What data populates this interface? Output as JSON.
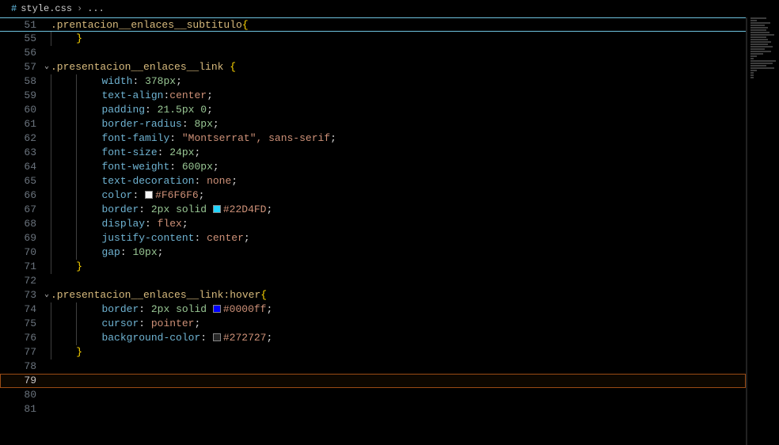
{
  "breadcrumb": {
    "icon": "#",
    "file": "style.css",
    "chev": "›",
    "scope": "..."
  },
  "sticky": {
    "num": "51",
    "sel": ".prentacion__enlaces__subtitulo",
    "brace": "{"
  },
  "lines": [
    {
      "num": "55",
      "indent": 1,
      "type": "brace-close",
      "text": "}"
    },
    {
      "num": "56",
      "indent": 0,
      "type": "empty",
      "text": ""
    },
    {
      "num": "57",
      "indent": 0,
      "type": "selector",
      "fold": true,
      "sel": ".presentacion__enlaces__link ",
      "brace": "{"
    },
    {
      "num": "58",
      "indent": 2,
      "type": "decl",
      "prop": "width",
      "colon": ": ",
      "val": "378px",
      "semi": ";"
    },
    {
      "num": "59",
      "indent": 2,
      "type": "decl",
      "prop": "text-align",
      "colon": ":",
      "val": "center",
      "semi": ";"
    },
    {
      "num": "60",
      "indent": 2,
      "type": "decl",
      "prop": "padding",
      "colon": ": ",
      "val": "21.5px 0",
      "semi": ";"
    },
    {
      "num": "61",
      "indent": 2,
      "type": "decl",
      "prop": "border-radius",
      "colon": ": ",
      "val": "8px",
      "semi": ";"
    },
    {
      "num": "62",
      "indent": 2,
      "type": "decl",
      "prop": "font-family",
      "colon": ": ",
      "str": "\"Montserrat\"",
      "rest": ", sans-serif",
      "semi": ";"
    },
    {
      "num": "63",
      "indent": 2,
      "type": "decl",
      "prop": "font-size",
      "colon": ": ",
      "val": "24px",
      "semi": ";"
    },
    {
      "num": "64",
      "indent": 2,
      "type": "decl",
      "prop": "font-weight",
      "colon": ": ",
      "val": "600px",
      "semi": ";"
    },
    {
      "num": "65",
      "indent": 2,
      "type": "decl",
      "prop": "text-decoration",
      "colon": ": ",
      "val": "none",
      "semi": ";"
    },
    {
      "num": "66",
      "indent": 2,
      "type": "color",
      "prop": "color",
      "colon": ": ",
      "swatch": "#F6F6F6",
      "val": "#F6F6F6",
      "semi": ";"
    },
    {
      "num": "67",
      "indent": 2,
      "type": "border",
      "prop": "border",
      "colon": ": ",
      "pre": "2px solid ",
      "swatch": "#22D4FD",
      "val": "#22D4FD",
      "semi": ";"
    },
    {
      "num": "68",
      "indent": 2,
      "type": "decl",
      "prop": "display",
      "colon": ": ",
      "val": "flex",
      "semi": ";"
    },
    {
      "num": "69",
      "indent": 2,
      "type": "decl",
      "prop": "justify-content",
      "colon": ": ",
      "val": "center",
      "semi": ";"
    },
    {
      "num": "70",
      "indent": 2,
      "type": "decl",
      "prop": "gap",
      "colon": ": ",
      "val": "10px",
      "semi": ";"
    },
    {
      "num": "71",
      "indent": 1,
      "type": "brace-close",
      "text": "}"
    },
    {
      "num": "72",
      "indent": 0,
      "type": "empty",
      "text": ""
    },
    {
      "num": "73",
      "indent": 0,
      "type": "selector",
      "fold": true,
      "sel": ".presentacion__enlaces__link:hover",
      "brace": "{"
    },
    {
      "num": "74",
      "indent": 2,
      "type": "border",
      "prop": "border",
      "colon": ": ",
      "pre": "2px solid ",
      "swatch": "#0000ff",
      "val": "#0000ff",
      "semi": ";"
    },
    {
      "num": "75",
      "indent": 2,
      "type": "decl",
      "prop": "cursor",
      "colon": ": ",
      "val": "pointer",
      "semi": ";"
    },
    {
      "num": "76",
      "indent": 2,
      "type": "color",
      "prop": "background-color",
      "colon": ": ",
      "swatch": "#272727",
      "val": "#272727",
      "semi": ";"
    },
    {
      "num": "77",
      "indent": 1,
      "type": "brace-close",
      "text": "}"
    },
    {
      "num": "78",
      "indent": 0,
      "type": "empty",
      "text": ""
    },
    {
      "num": "79",
      "indent": 0,
      "type": "cursor",
      "text": ""
    },
    {
      "num": "80",
      "indent": 0,
      "type": "empty",
      "text": ""
    },
    {
      "num": "81",
      "indent": 0,
      "type": "empty",
      "text": ""
    }
  ],
  "minimap_widths": [
    20,
    8,
    25,
    18,
    22,
    20,
    24,
    30,
    20,
    22,
    26,
    22,
    28,
    18,
    26,
    16,
    8,
    4,
    32,
    28,
    20,
    30,
    8,
    4,
    4,
    4
  ]
}
